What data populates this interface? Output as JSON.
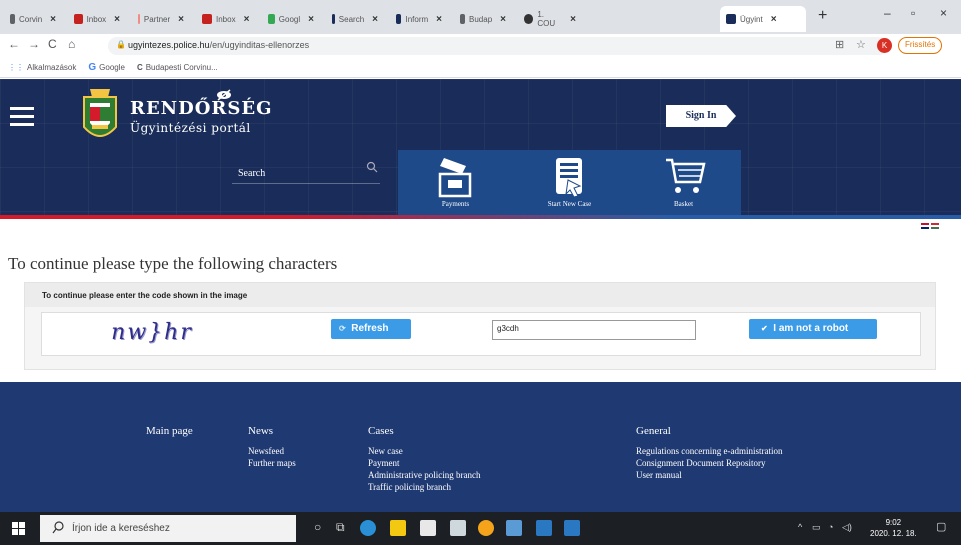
{
  "browser": {
    "tabs": [
      {
        "label": "Corvin",
        "color": "#5f6368"
      },
      {
        "label": "Inbox",
        "color": "#c5221f"
      },
      {
        "label": "Partner",
        "color": "#f28b82"
      },
      {
        "label": "Inbox",
        "color": "#c5221f"
      },
      {
        "label": "Googl",
        "color": "#34a853"
      },
      {
        "label": "Search",
        "color": "#1a2d5a"
      },
      {
        "label": "Inform",
        "color": "#1a2d5a"
      },
      {
        "label": "Budap",
        "color": "#5f6368"
      },
      {
        "label": "1. COU",
        "color": "#333333"
      },
      {
        "label": "Ügyint",
        "color": "#1a2d5a"
      }
    ],
    "url_host": "ugyintezes.police.hu",
    "url_path": "/en/ugyinditas-ellenorzes",
    "sync_label": "Frissítés",
    "avatar_letter": "K",
    "bookmarks": [
      "Alkalmazások",
      "Google",
      "Budapesti Corvinu..."
    ]
  },
  "site": {
    "brand_title": "RENDŐRSÉG",
    "brand_subtitle": "Ügyintézési portál",
    "sign_in": "Sign In",
    "search_label": "Search",
    "nav": {
      "payments": "Payments",
      "start_new_case": "Start New Case",
      "basket": "Basket"
    }
  },
  "content": {
    "title": "To continue please type the following characters",
    "panel_heading": "To continue please enter the code shown in the image",
    "captcha_text": "nw}hr",
    "refresh_label": "Refresh",
    "code_value": "g3cdh",
    "robot_label": "I am not a robot",
    "accent_color": "#3b9be6"
  },
  "footer": {
    "main_page": "Main page",
    "news": {
      "heading": "News",
      "items": [
        "Newsfeed",
        "Further maps"
      ]
    },
    "cases": {
      "heading": "Cases",
      "items": [
        "New case",
        "Payment",
        "Administrative policing branch",
        "Traffic policing branch"
      ]
    },
    "general": {
      "heading": "General",
      "items": [
        "Regulations concerning e-administration",
        "Consignment Document Repository",
        "User manual"
      ]
    }
  },
  "taskbar": {
    "search_placeholder": "Írjon ide a kereséshez",
    "time": "9:02",
    "date": "2020. 12. 18."
  }
}
